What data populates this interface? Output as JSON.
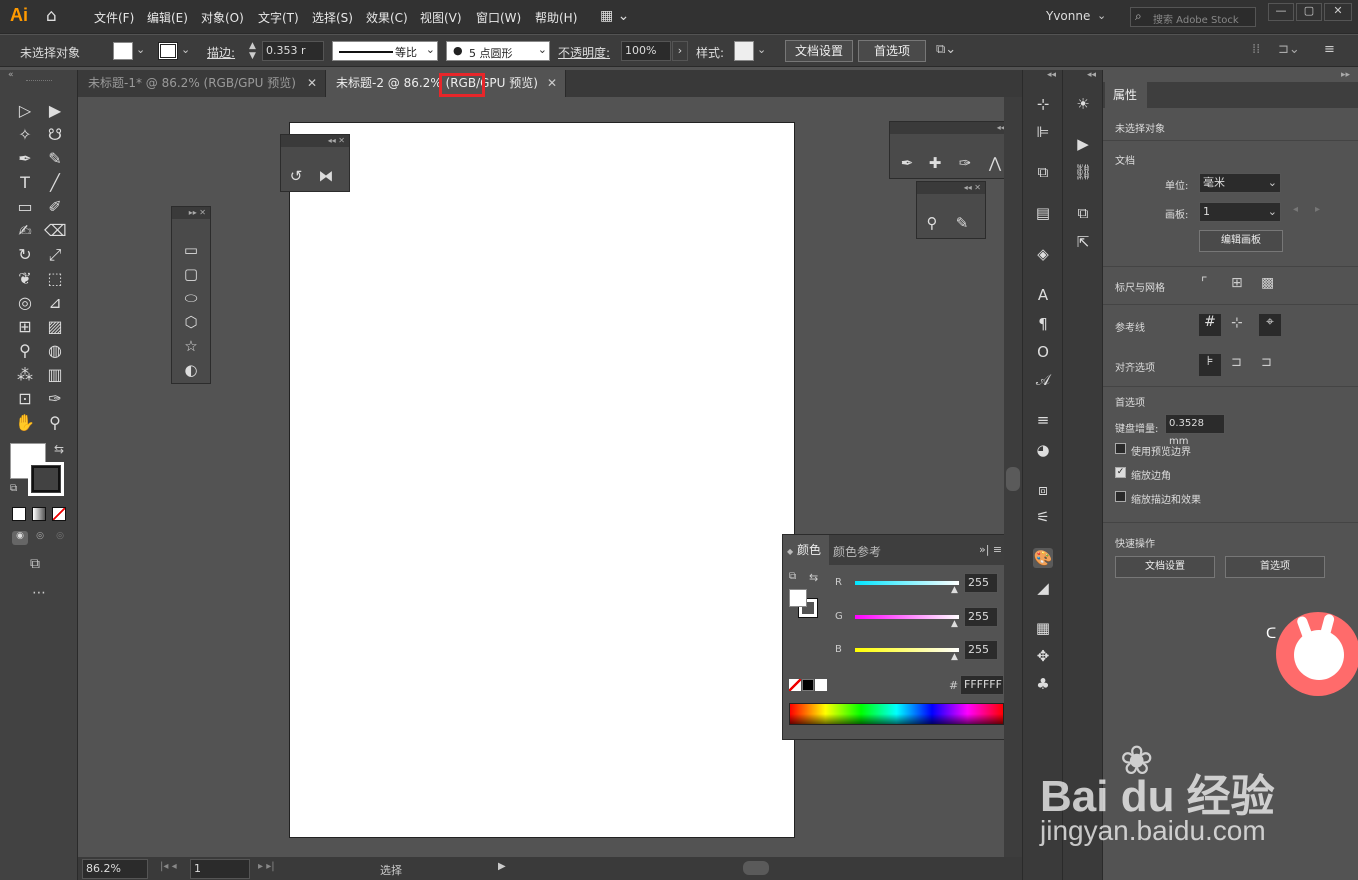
{
  "app": {
    "logo": "Ai"
  },
  "menu": [
    "文件(F)",
    "编辑(E)",
    "对象(O)",
    "文字(T)",
    "选择(S)",
    "效果(C)",
    "视图(V)",
    "窗口(W)",
    "帮助(H)"
  ],
  "user": "Yvonne",
  "search": {
    "placeholder": "搜索 Adobe Stock"
  },
  "control": {
    "no_selection": "未选择对象",
    "stroke_label": "描边:",
    "stroke_value": "0.353 r",
    "stroke_profile": "等比",
    "brush": "5 点圆形",
    "opacity_label": "不透明度:",
    "opacity_value": "100%",
    "style_label": "样式:",
    "doc_setup": "文档设置",
    "prefs": "首选项"
  },
  "tabs": [
    {
      "label": "未标题-1* @ 86.2% (RGB/GPU 预览)",
      "active": false
    },
    {
      "label": "未标题-2 @ 86.2% (RGB/GPU 预览)",
      "active": true
    }
  ],
  "color_panel": {
    "tabs": [
      "颜色",
      "颜色参考"
    ],
    "channels": [
      {
        "name": "R",
        "value": "255",
        "color": "#00e5ff"
      },
      {
        "name": "G",
        "value": "255",
        "color": "#ff00ff"
      },
      {
        "name": "B",
        "value": "255",
        "color": "#ffff00"
      }
    ],
    "hash": "#",
    "hex": "FFFFFF"
  },
  "status": {
    "zoom": "86.2%",
    "page": "1",
    "tool": "选择"
  },
  "properties": {
    "tab": "属性",
    "no_selection": "未选择对象",
    "doc_section": "文档",
    "unit_label": "单位:",
    "unit_value": "毫米",
    "artboard_label": "画板:",
    "artboard_value": "1",
    "edit_artboards": "编辑画板",
    "rulers_grid": "标尺与网格",
    "guides": "参考线",
    "snap": "对齐选项",
    "prefs_section": "首选项",
    "keyboard_inc_label": "键盘增量:",
    "keyboard_inc_value": "0.3528 mm",
    "opt_preview_bounds": "使用预览边界",
    "opt_scale_corners": "缩放边角",
    "opt_scale_strokes": "缩放描边和效果",
    "quick_actions": "快速操作",
    "doc_setup_btn": "文档设置",
    "prefs_btn": "首选项"
  },
  "watermark": {
    "brand": "Bai du 经验",
    "url": "jingyan.baidu.com"
  },
  "highlight_color": "#e8262a"
}
